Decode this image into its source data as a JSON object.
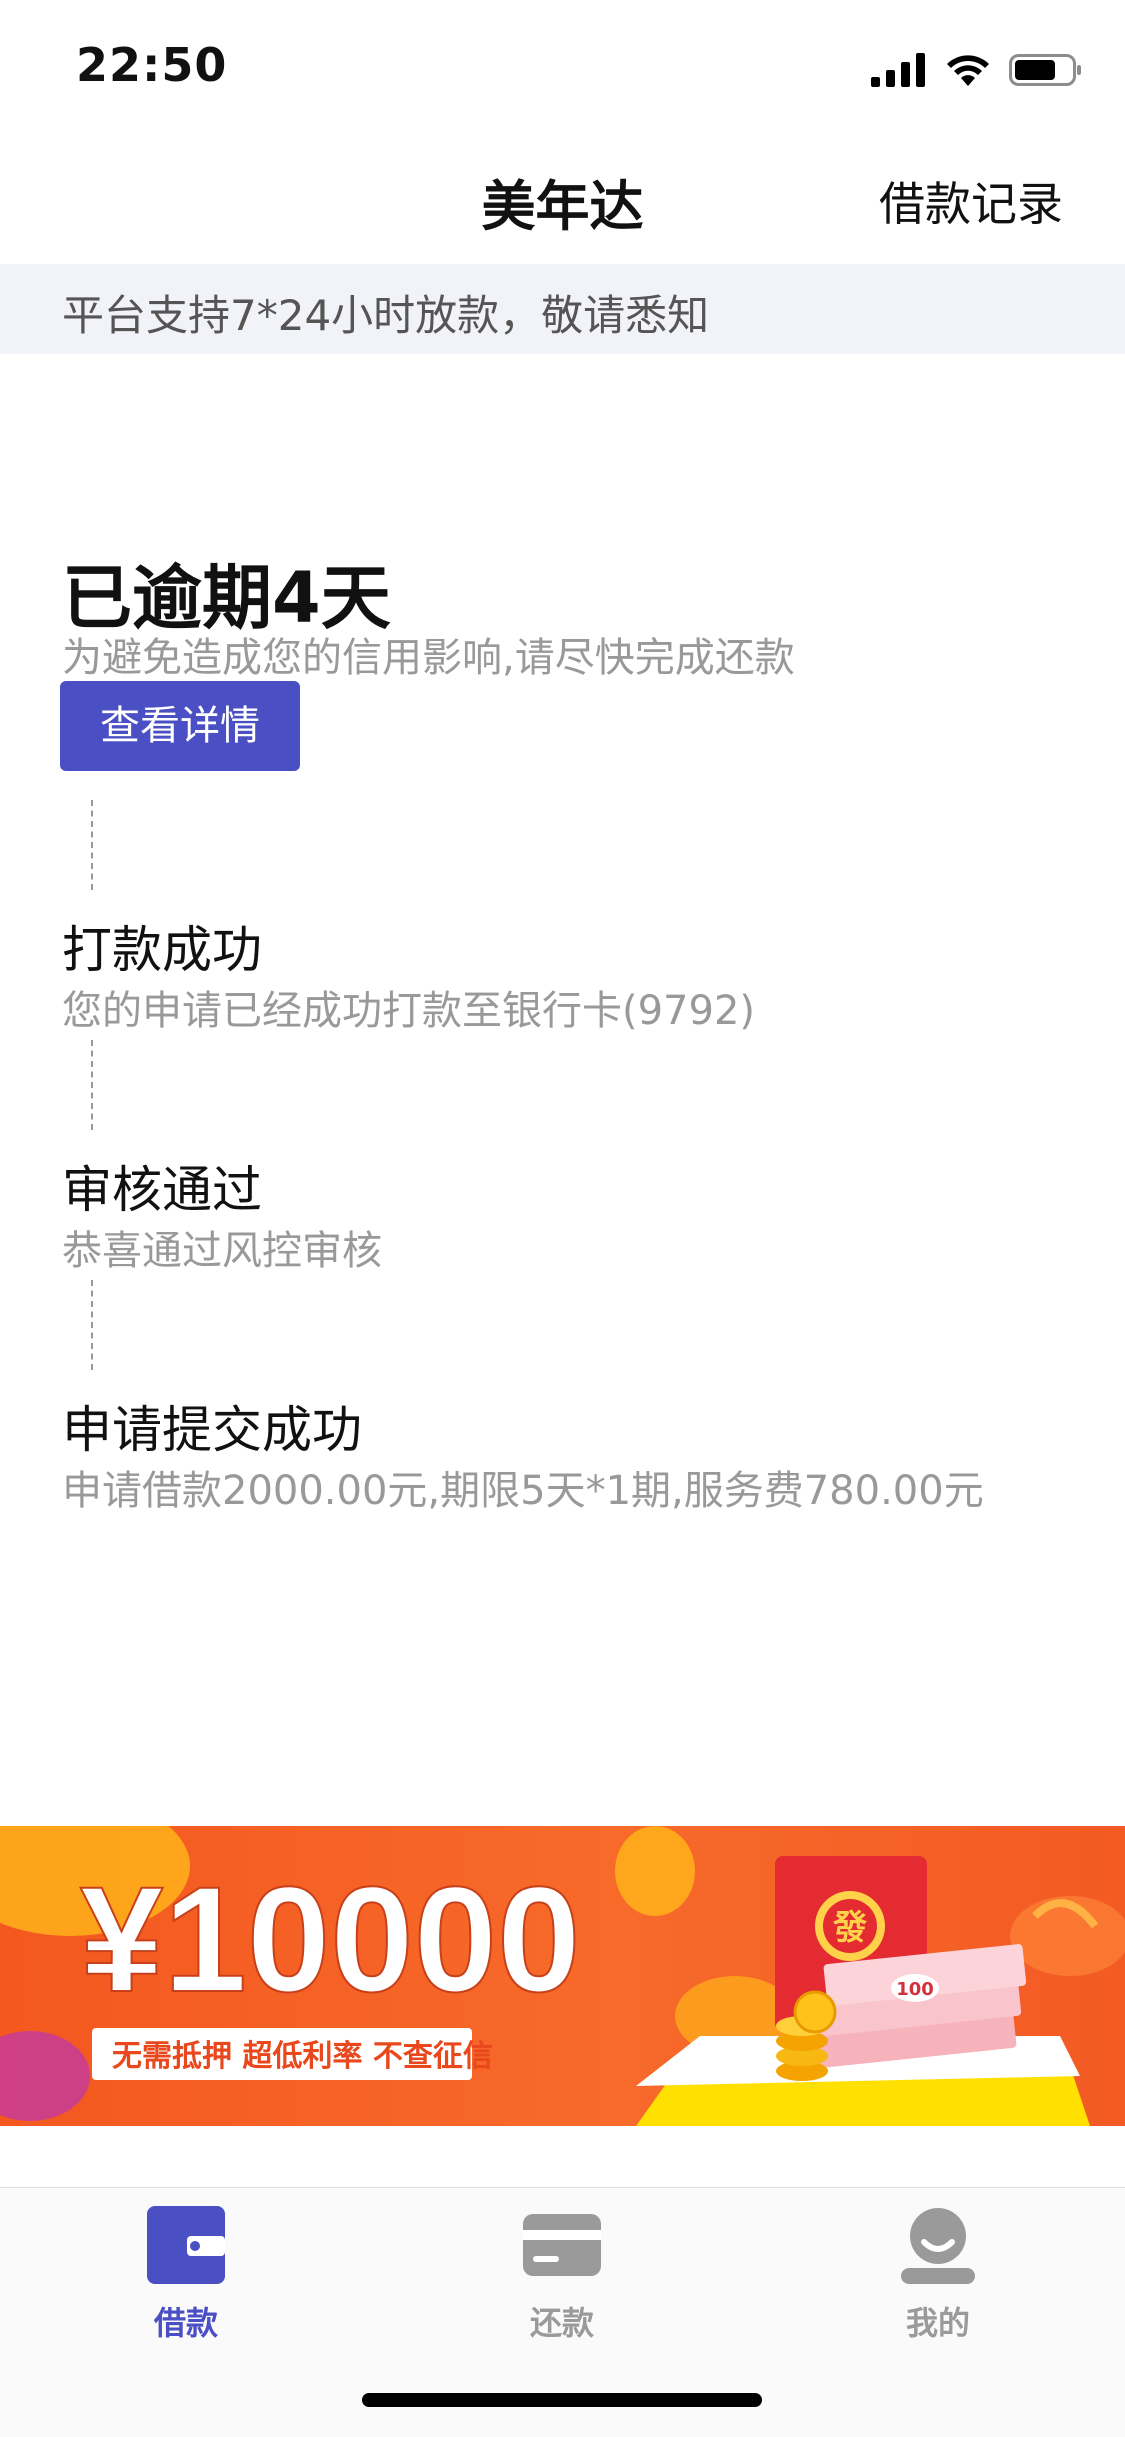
{
  "status_bar": {
    "time": "22:50"
  },
  "nav": {
    "title": "美年达",
    "right_link": "借款记录"
  },
  "notice": {
    "text": "平台支持7*24小时放款，敬请悉知"
  },
  "overdue": {
    "title": "已逾期4天",
    "description": "为避免造成您的信用影响,请尽快完成还款",
    "button_label": "查看详情"
  },
  "steps": [
    {
      "title": "打款成功",
      "description": "您的申请已经成功打款至银行卡(9792)"
    },
    {
      "title": "审核通过",
      "description": "恭喜通过风控审核"
    },
    {
      "title": "申请提交成功",
      "description": "申请借款2000.00元,期限5天*1期,服务费780.00元"
    }
  ],
  "banner": {
    "amount": "¥10000",
    "tagline": "无需抵押  超低利率  不查征信",
    "envelope_char": "發",
    "note_value": "100"
  },
  "tabs": [
    {
      "label": "借款",
      "icon": "wallet-icon",
      "active": true
    },
    {
      "label": "还款",
      "icon": "card-icon",
      "active": false
    },
    {
      "label": "我的",
      "icon": "person-icon",
      "active": false
    }
  ],
  "colors": {
    "accent": "#4a4fc4",
    "inactive_tab": "#9a9a9a",
    "banner_orange": "#f25a2a",
    "banner_yellow": "#ffd200"
  }
}
